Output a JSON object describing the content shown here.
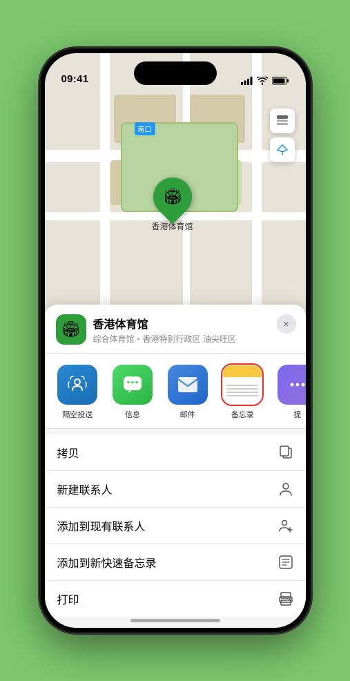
{
  "statusBar": {
    "time": "09:41",
    "signal": "●●●●",
    "wifi": "WiFi",
    "battery": "Battery"
  },
  "map": {
    "exitSign": "南口",
    "pinLabel": "香港体育馆"
  },
  "locationCard": {
    "name": "香港体育馆",
    "description": "综合体育馆・香港特别行政区 油尖旺区",
    "closeLabel": "×"
  },
  "shareItems": [
    {
      "id": "airdrop",
      "label": "隔空投送"
    },
    {
      "id": "message",
      "label": "信息"
    },
    {
      "id": "mail",
      "label": "邮件"
    },
    {
      "id": "notes",
      "label": "备忘录"
    },
    {
      "id": "more",
      "label": "提"
    }
  ],
  "actionItems": [
    {
      "id": "copy",
      "label": "拷贝",
      "icon": "copy"
    },
    {
      "id": "new-contact",
      "label": "新建联系人",
      "icon": "person"
    },
    {
      "id": "add-to-contact",
      "label": "添加到现有联系人",
      "icon": "person-add"
    },
    {
      "id": "quick-note",
      "label": "添加到新快速备忘录",
      "icon": "note"
    },
    {
      "id": "print",
      "label": "打印",
      "icon": "print"
    }
  ]
}
